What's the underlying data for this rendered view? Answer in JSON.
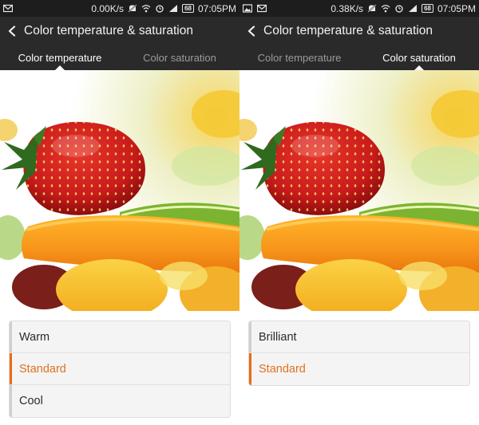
{
  "screens": [
    {
      "status": {
        "speed": "0.00K/s",
        "battery": "68",
        "time": "07:05PM"
      },
      "title": "Color temperature & saturation",
      "tabs": [
        {
          "label": "Color temperature",
          "active": true
        },
        {
          "label": "Color saturation",
          "active": false
        }
      ],
      "options": [
        {
          "label": "Warm",
          "selected": false
        },
        {
          "label": "Standard",
          "selected": true
        },
        {
          "label": "Cool",
          "selected": false
        }
      ]
    },
    {
      "status": {
        "speed": "0.38K/s",
        "battery": "68",
        "time": "07:05PM"
      },
      "title": "Color temperature & saturation",
      "tabs": [
        {
          "label": "Color temperature",
          "active": false
        },
        {
          "label": "Color saturation",
          "active": true
        }
      ],
      "options": [
        {
          "label": "Brilliant",
          "selected": false
        },
        {
          "label": "Standard",
          "selected": true
        }
      ]
    }
  ],
  "colors": {
    "accent": "#ec6a12",
    "selected_text": "#e0711d",
    "bar_bg": "#2a2a2a",
    "status_bg": "#1d1d1d"
  },
  "icons": [
    "mail-icon",
    "image-icon",
    "mute-icon",
    "wifi-icon",
    "alarm-icon",
    "signal-icon",
    "battery-icon",
    "back-chevron-icon"
  ]
}
